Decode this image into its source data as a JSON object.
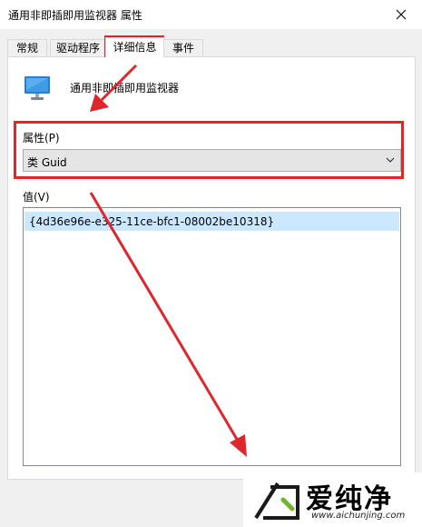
{
  "window": {
    "title": "通用非即插即用监视器 属性"
  },
  "tabs": [
    {
      "label": "常规",
      "active": false
    },
    {
      "label": "驱动程序",
      "active": false
    },
    {
      "label": "详细信息",
      "active": true
    },
    {
      "label": "事件",
      "active": false
    }
  ],
  "device": {
    "icon": "monitor-icon",
    "name": "通用非即插即用监视器"
  },
  "property": {
    "label": "属性(P)",
    "selected": "类 Guid"
  },
  "value": {
    "label": "值(V)",
    "items": [
      "{4d36e96e-e325-11ce-bfc1-08002be10318}"
    ]
  },
  "annotations": {
    "color": "#e0262d"
  },
  "watermark": {
    "brand": "爱纯净",
    "url": "www.aichunjing.com"
  }
}
